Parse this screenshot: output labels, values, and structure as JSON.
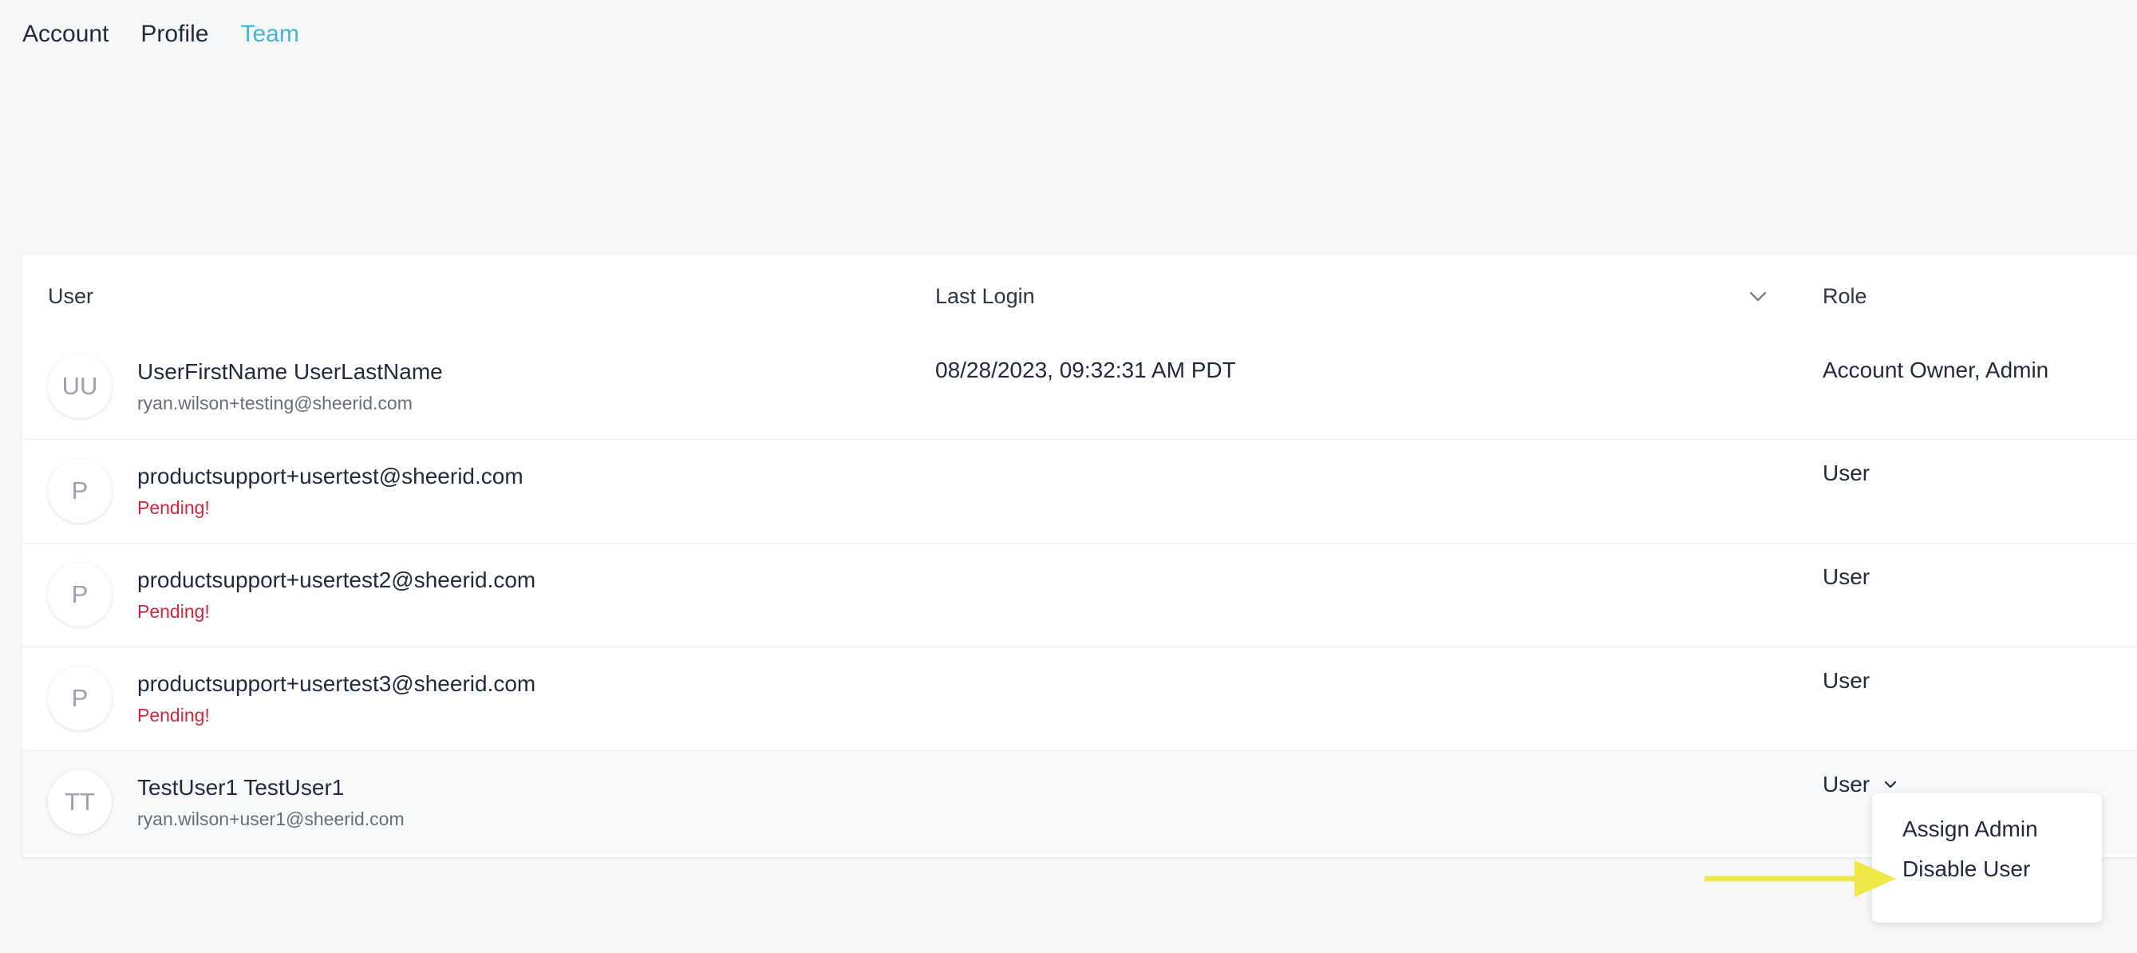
{
  "tabs": [
    {
      "label": "Account",
      "active": false
    },
    {
      "label": "Profile",
      "active": false
    },
    {
      "label": "Team",
      "active": true
    }
  ],
  "table": {
    "headers": {
      "user": "User",
      "last_login": "Last Login",
      "role": "Role"
    },
    "rows": [
      {
        "initials": "UU",
        "name": "UserFirstName UserLastName",
        "sub": "ryan.wilson+testing@sheerid.com",
        "last_login": "08/28/2023, 09:32:31 AM PDT",
        "role": "Account Owner, Admin"
      },
      {
        "initials": "P",
        "name": "productsupport+usertest@sheerid.com",
        "sub": "Pending!",
        "last_login": "",
        "role": "User"
      },
      {
        "initials": "P",
        "name": "productsupport+usertest2@sheerid.com",
        "sub": "Pending!",
        "last_login": "",
        "role": "User"
      },
      {
        "initials": "P",
        "name": "productsupport+usertest3@sheerid.com",
        "sub": "Pending!",
        "last_login": "",
        "role": "User"
      },
      {
        "initials": "TT",
        "name": "TestUser1 TestUser1",
        "sub": "ryan.wilson+user1@sheerid.com",
        "last_login": "",
        "role": "User"
      }
    ]
  },
  "role_menu": {
    "items": [
      "Assign Admin",
      "Disable User"
    ]
  },
  "colors": {
    "accent": "#43b6d6",
    "pending": "#d2263d",
    "annotation_arrow": "#f0e846"
  },
  "icons": {
    "sort": "chevron-down-icon",
    "role_dropdown": "chevron-down-icon",
    "annotation": "arrow-right-icon"
  }
}
